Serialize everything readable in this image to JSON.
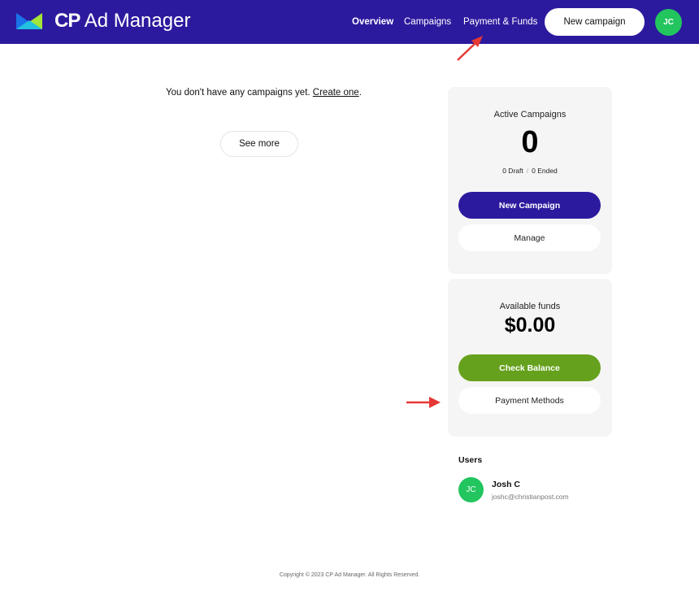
{
  "header": {
    "brand_prefix": "CP",
    "brand_suffix": " Ad Manager",
    "nav": [
      {
        "label": "Overview",
        "active": true
      },
      {
        "label": "Campaigns",
        "active": false
      },
      {
        "label": "Payment & Funds",
        "active": false
      }
    ],
    "new_campaign_label": "New campaign",
    "avatar_initials": "JC"
  },
  "main": {
    "empty_message": "You don't have any campaigns yet. ",
    "create_link": "Create one",
    "create_link_suffix": ".",
    "see_more_label": "See more"
  },
  "campaigns_card": {
    "title": "Active Campaigns",
    "active_count": "0",
    "draft_text": "0 Draft",
    "separator": "/",
    "ended_text": "0 Ended",
    "new_campaign_label": "New Campaign",
    "manage_label": "Manage"
  },
  "funds_card": {
    "title": "Available funds",
    "amount": "$0.00",
    "check_balance_label": "Check Balance",
    "payment_methods_label": "Payment Methods"
  },
  "users": {
    "title": "Users",
    "list": [
      {
        "initials": "JC",
        "name": "Josh C",
        "email": "joshc@christianpost.com"
      }
    ]
  },
  "footer": {
    "copyright": "Copyright © 2023 CP Ad Manager. All Rights Reserved."
  },
  "colors": {
    "brand": "#2c1a9e",
    "accent_green": "#65a11d",
    "avatar_green": "#22c55e",
    "annotation_red": "#e53935"
  }
}
